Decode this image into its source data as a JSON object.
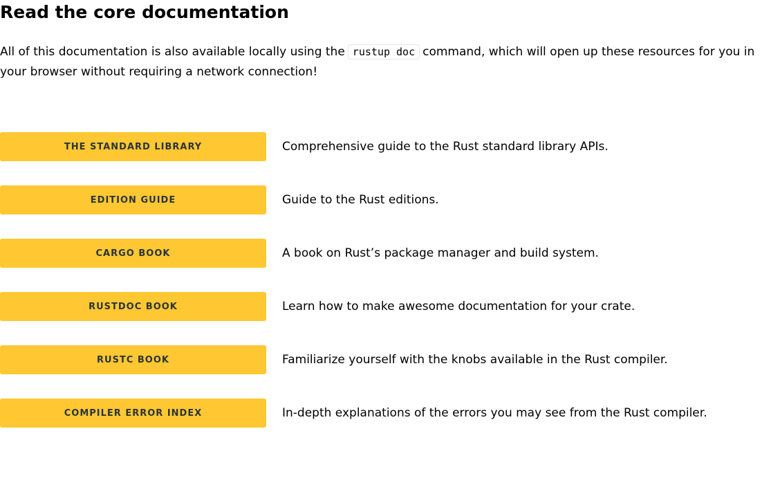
{
  "section": {
    "title": "Read the core documentation",
    "intro_before": "All of this documentation is also available locally using the",
    "intro_code": "rustup doc",
    "intro_after": "command, which will open up these resources for you in your browser without requiring a network connection!"
  },
  "docs": [
    {
      "label": "THE STANDARD LIBRARY",
      "description": "Comprehensive guide to the Rust standard library APIs."
    },
    {
      "label": "EDITION GUIDE",
      "description": "Guide to the Rust editions."
    },
    {
      "label": "CARGO BOOK",
      "description": "A book on Rust’s package manager and build system."
    },
    {
      "label": "RUSTDOC BOOK",
      "description": "Learn how to make awesome documentation for your crate."
    },
    {
      "label": "RUSTC BOOK",
      "description": "Familiarize yourself with the knobs available in the Rust compiler."
    },
    {
      "label": "COMPILER ERROR INDEX",
      "description": "In-depth explanations of the errors you may see from the Rust compiler."
    }
  ],
  "colors": {
    "button_bg": "#ffc832",
    "button_text": "#2a3439",
    "body_text": "#000000",
    "code_border": "#e6e6e6"
  }
}
